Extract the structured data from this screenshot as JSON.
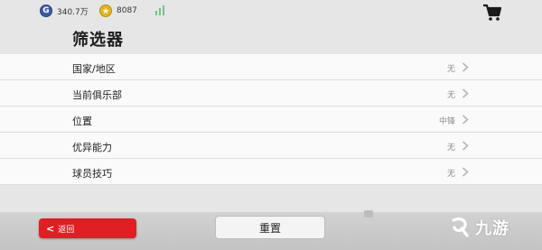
{
  "header": {
    "currency_g": {
      "icon": "g-coin-icon",
      "letter": "G",
      "value": "340.7万"
    },
    "currency_coin": {
      "icon": "gold-coin-icon",
      "value": "8087"
    },
    "cart_icon": "shopping-cart-icon"
  },
  "title": "筛选器",
  "filters": [
    {
      "label": "国家/地区",
      "value": "无"
    },
    {
      "label": "当前俱乐部",
      "value": "无"
    },
    {
      "label": "位置",
      "value": "中锋"
    },
    {
      "label": "优异能力",
      "value": "无"
    },
    {
      "label": "球员技巧",
      "value": "无"
    }
  ],
  "footer": {
    "back_label": "返回",
    "reset_label": "重置"
  },
  "watermark": {
    "text": "九游",
    "icon": "jiuyou-logo-icon"
  },
  "colors": {
    "accent_red": "#e01f24",
    "panel_bg": "#fafafa",
    "page_bg": "#e6e6e6"
  }
}
